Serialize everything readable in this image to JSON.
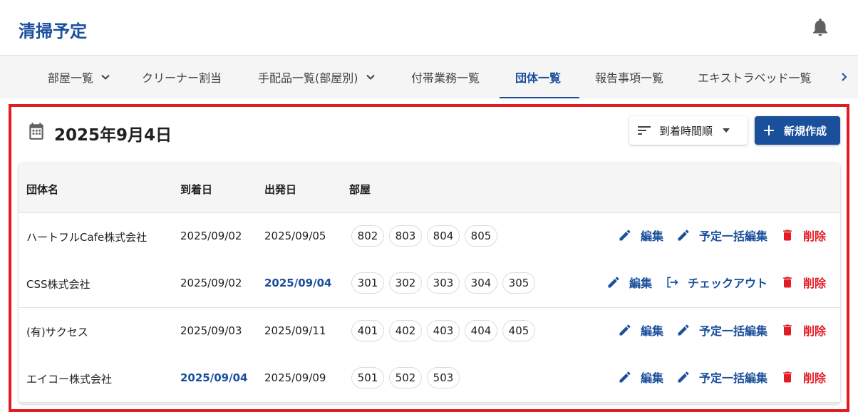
{
  "app": {
    "title": "清掃予定"
  },
  "tabs": [
    {
      "label": "部屋一覧",
      "has_dropdown": true
    },
    {
      "label": "クリーナー割当",
      "has_dropdown": false
    },
    {
      "label": "手配品一覧(部屋別)",
      "has_dropdown": true
    },
    {
      "label": "付帯業務一覧",
      "has_dropdown": false
    },
    {
      "label": "団体一覧",
      "has_dropdown": false,
      "active": true
    },
    {
      "label": "報告事項一覧",
      "has_dropdown": false
    },
    {
      "label": "エキストラベッド一覧",
      "has_dropdown": false
    }
  ],
  "content": {
    "date_title": "2025年9月4日",
    "sort_label": "到着時間順",
    "new_label": "新規作成"
  },
  "table": {
    "headers": [
      "団体名",
      "到着日",
      "出発日",
      "部屋"
    ],
    "rows": [
      {
        "name": "ハートフルCafe株式会社",
        "arrival": "2025/09/02",
        "arrival_today": false,
        "departure": "2025/09/05",
        "departure_today": false,
        "rooms": [
          "802",
          "803",
          "804",
          "805"
        ],
        "actions": [
          "編集",
          "予定一括編集",
          "削除"
        ]
      },
      {
        "name": "CSS株式会社",
        "arrival": "2025/09/02",
        "arrival_today": false,
        "departure": "2025/09/04",
        "departure_today": true,
        "rooms": [
          "301",
          "302",
          "303",
          "304",
          "305"
        ],
        "actions": [
          "編集",
          "チェックアウト",
          "削除"
        ]
      },
      {
        "name": "(有)サクセス",
        "arrival": "2025/09/03",
        "arrival_today": false,
        "departure": "2025/09/11",
        "departure_today": false,
        "rooms": [
          "401",
          "402",
          "403",
          "404",
          "405"
        ],
        "actions": [
          "編集",
          "予定一括編集",
          "削除"
        ]
      },
      {
        "name": "エイコー株式会社",
        "arrival": "2025/09/04",
        "arrival_today": true,
        "departure": "2025/09/09",
        "departure_today": false,
        "rooms": [
          "501",
          "502",
          "503"
        ],
        "actions": [
          "編集",
          "予定一括編集",
          "削除"
        ]
      }
    ]
  },
  "colors": {
    "primary": "#1a4f9c",
    "danger": "#e31b23",
    "highlight_frame": "#e31b23"
  },
  "icons": {
    "bell": "bell-icon",
    "calendar": "calendar-icon",
    "sort": "sort-icon",
    "plus": "plus-icon",
    "edit": "pencil-icon",
    "checkout": "logout-icon",
    "delete": "trash-icon",
    "chevron": "chevron-down-icon",
    "scroll": "chevron-right-icon"
  }
}
